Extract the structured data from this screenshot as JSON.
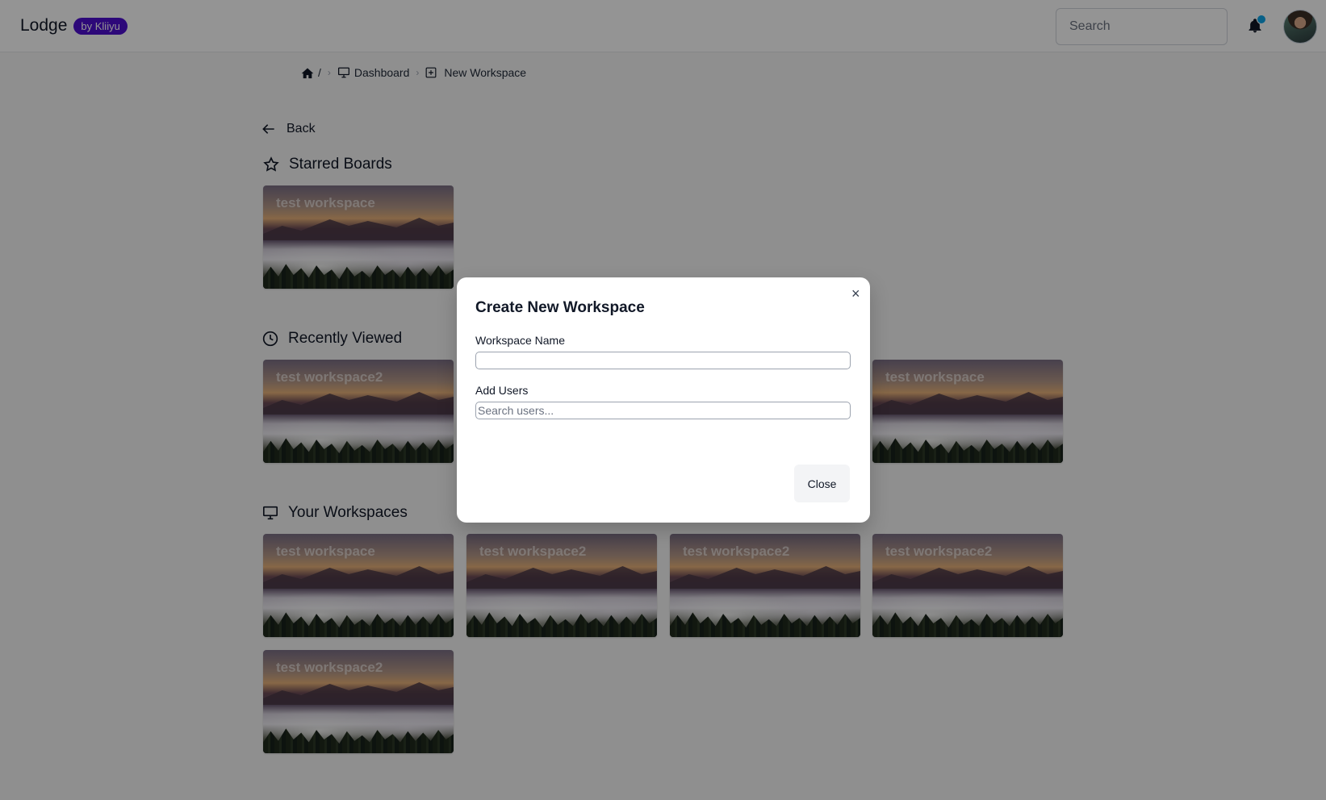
{
  "header": {
    "brand": "Lodge",
    "badge": "by Kliiyu",
    "search_placeholder": "Search",
    "bell_icon": "bell-icon",
    "avatar": "user-avatar"
  },
  "breadcrumb": {
    "home_sep": "/",
    "items": [
      {
        "label": "Dashboard",
        "icon": "monitor-icon"
      },
      {
        "label": "New Workspace",
        "icon": "plus-square-icon"
      }
    ]
  },
  "back_label": "Back",
  "sections": {
    "starred": {
      "title": "Starred Boards",
      "cards": [
        "test workspace"
      ]
    },
    "recent": {
      "title": "Recently Viewed",
      "cards": [
        "test workspace2",
        "test workspace"
      ]
    },
    "workspaces": {
      "title": "Your Workspaces",
      "cards": [
        "test workspace",
        "test workspace2",
        "test workspace2",
        "test workspace2",
        "test workspace2"
      ]
    }
  },
  "modal": {
    "title": "Create New Workspace",
    "close_symbol": "×",
    "workspace_name_label": "Workspace Name",
    "workspace_name_value": "",
    "add_users_label": "Add Users",
    "add_users_placeholder": "Search users...",
    "close_button": "Close"
  }
}
